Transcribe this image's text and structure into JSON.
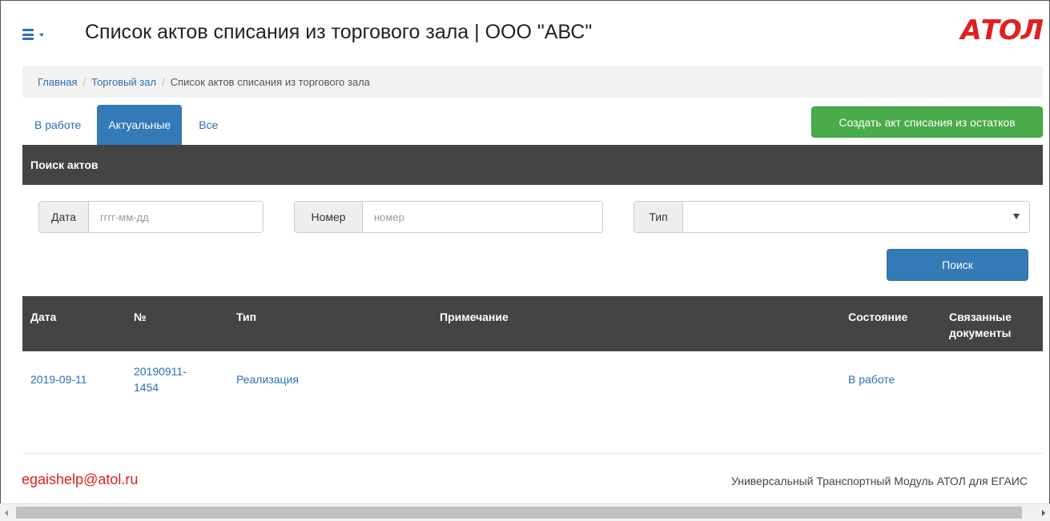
{
  "header": {
    "title": "Список актов списания из торгового зала | ООО \"АВС\"",
    "logo": "АТОЛ"
  },
  "breadcrumb": {
    "items": [
      "Главная",
      "Торговый зал"
    ],
    "separator": "/",
    "current": "Список актов списания из торгового зала"
  },
  "tabs": [
    {
      "label": "В работе",
      "active": false
    },
    {
      "label": "Актуальные",
      "active": true
    },
    {
      "label": "Все",
      "active": false
    }
  ],
  "actions": {
    "create_label": "Создать акт списания из остатков"
  },
  "search": {
    "panel_title": "Поиск актов",
    "date_label": "Дата",
    "date_placeholder": "гггг-мм-дд",
    "number_label": "Номер",
    "number_placeholder": "номер",
    "type_label": "Тип",
    "type_value": "",
    "button_label": "Поиск"
  },
  "table": {
    "columns": [
      "Дата",
      "№",
      "Тип",
      "Примечание",
      "Состояние",
      "Связанные документы"
    ],
    "rows": [
      {
        "date": "2019-09-11",
        "number": "20190911-1454",
        "type": "Реализация",
        "note": "",
        "status": "В работе",
        "related": ""
      }
    ]
  },
  "footer": {
    "email": "egaishelp@atol.ru",
    "product": "Универсальный Транспортный Модуль АТОЛ для ЕГАИС"
  },
  "colors": {
    "primary": "#337ab7",
    "link": "#2a6fb6",
    "success": "#4aab4a",
    "brand_red": "#e02020",
    "panel_dark": "#444444"
  }
}
